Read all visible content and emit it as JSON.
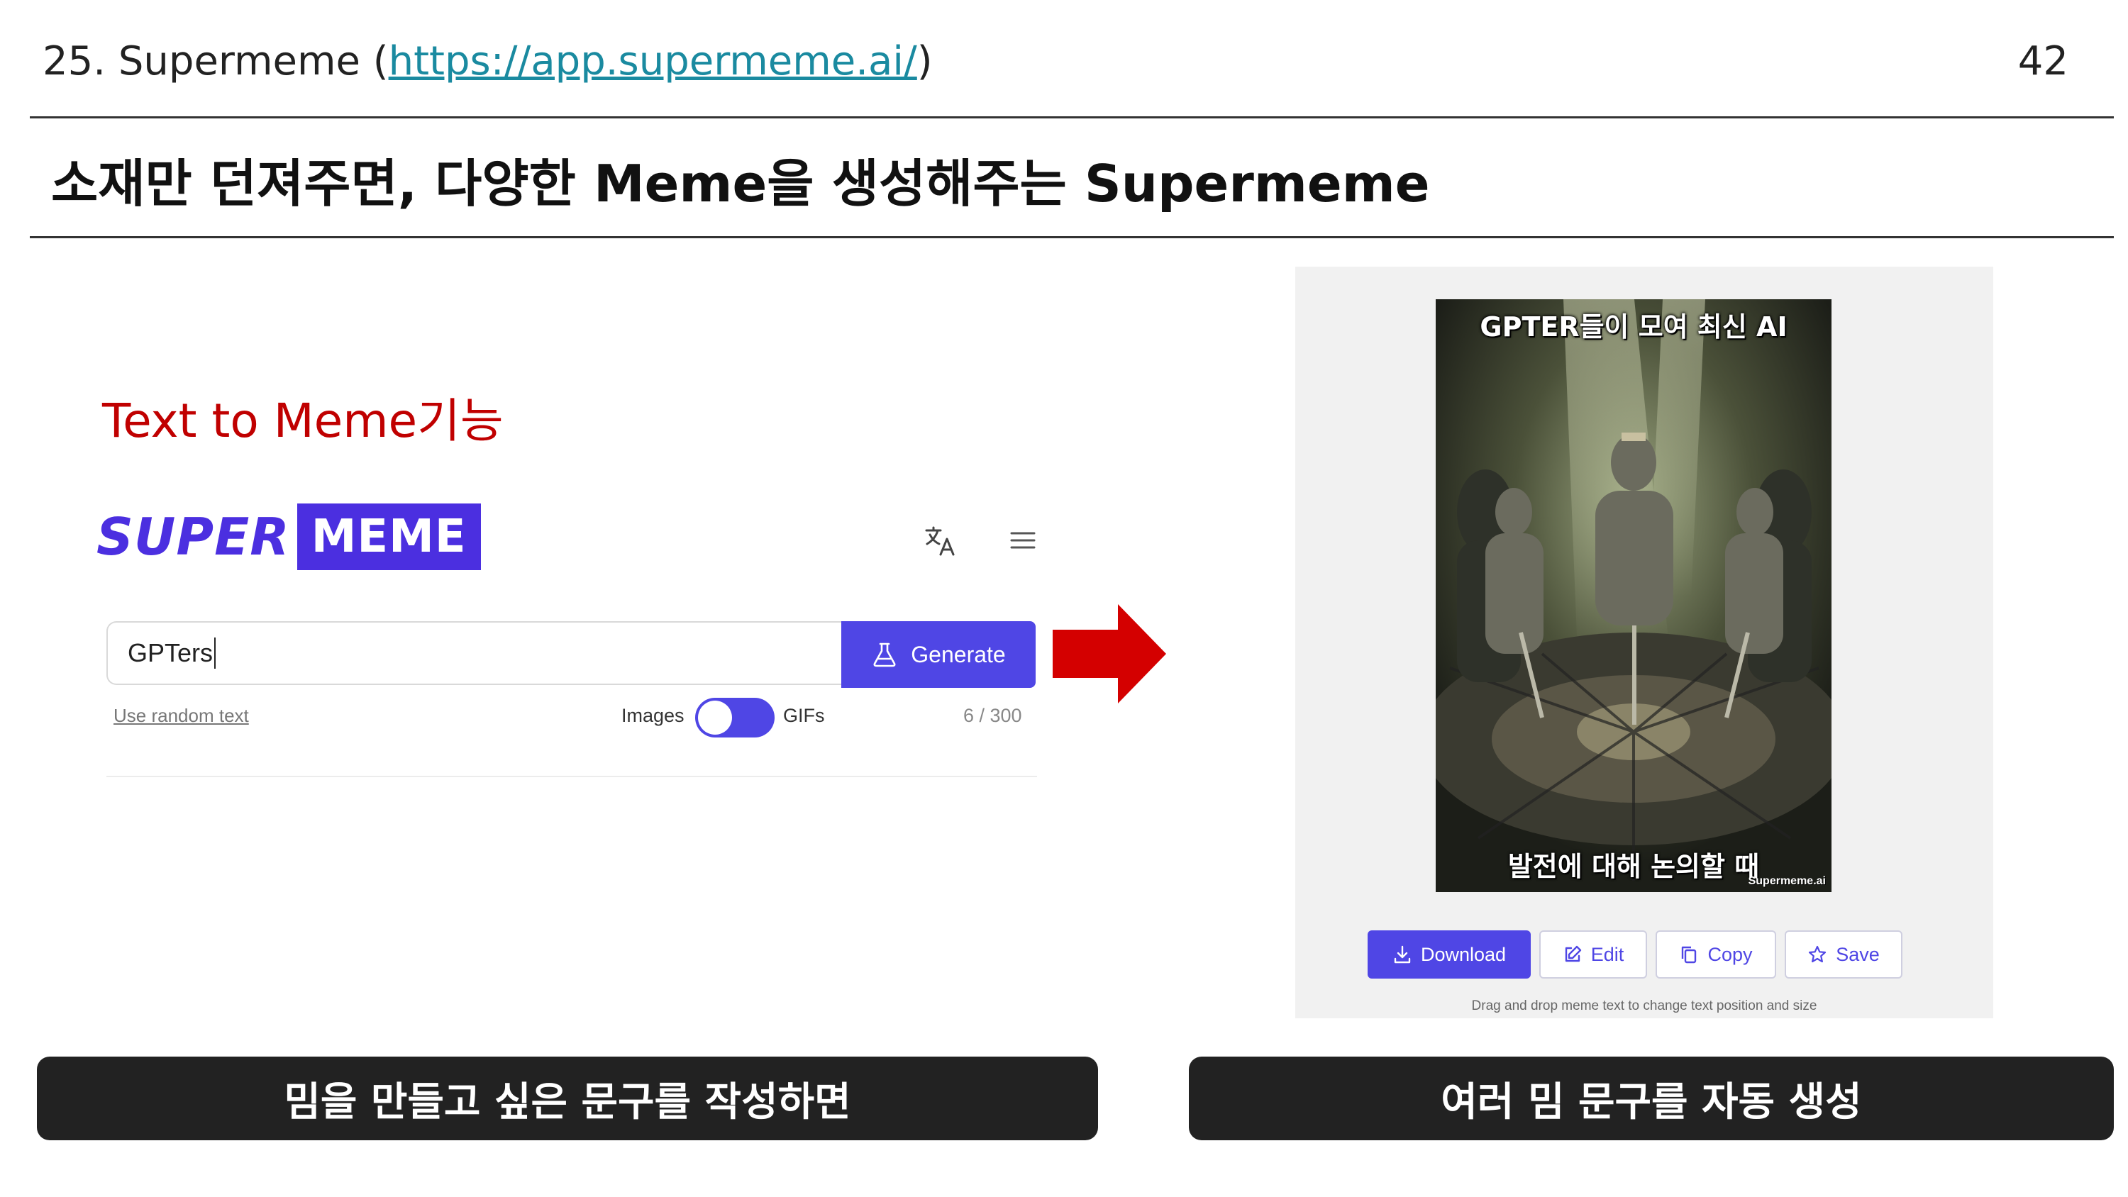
{
  "header": {
    "prefix": "25. Supermeme (",
    "link_text": "https://app.supermeme.ai/",
    "suffix": ")",
    "page_number": "42"
  },
  "title": "소재만 던져주면, 다양한 Meme을 생성해주는 Supermeme",
  "left_section": {
    "feature_label": "Text to Meme기능",
    "logo": {
      "part1": "SUPER",
      "part2": "MEME"
    },
    "icons": {
      "translate": "translate-icon",
      "menu": "hamburger-menu-icon"
    },
    "input": {
      "value": "GPTers"
    },
    "generate_label": "Generate",
    "random_text_link": "Use random text",
    "toggle": {
      "left_label": "Images",
      "right_label": "GIFs",
      "state": "images"
    },
    "counter": "6 / 300"
  },
  "right_section": {
    "meme": {
      "top_text": "GPTER들이 모여 최신 AI",
      "bottom_text": "발전에 대해 논의할 때",
      "watermark": "Supermeme.ai"
    },
    "buttons": {
      "download": "Download",
      "edit": "Edit",
      "copy": "Copy",
      "save": "Save"
    },
    "hint": "Drag and drop meme text to change text position and size"
  },
  "captions": {
    "left": "밈을 만들고 싶은 문구를 작성하면",
    "right": "여러 밈 문구를 자동 생성"
  },
  "colors": {
    "accent": "#4f46e5",
    "feature_label": "#c00000",
    "arrow": "#d40000",
    "caption_bg": "#222222",
    "link": "#1a8aa0"
  }
}
